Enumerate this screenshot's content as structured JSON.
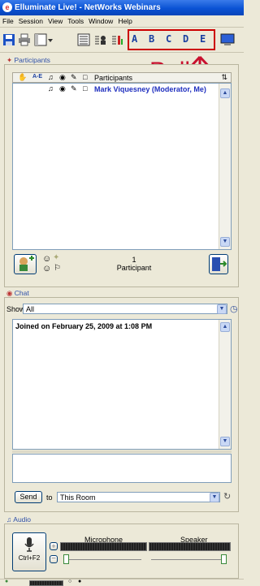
{
  "window": {
    "title": "Elluminate Live! - NetWorks Webinars"
  },
  "menu": [
    "File",
    "Session",
    "View",
    "Tools",
    "Window",
    "Help"
  ],
  "toolbar": {
    "poll_buttons": [
      "A",
      "B",
      "C",
      "D",
      "E"
    ]
  },
  "annotation": {
    "label": "Poll"
  },
  "participants": {
    "panel_title": "Participants",
    "column_header": "Participants",
    "list": [
      {
        "name": "Mark Viquesney (Moderator, Me)"
      }
    ],
    "count": "1",
    "count_label": "Participant"
  },
  "chat": {
    "panel_title": "Chat",
    "show_label": "Show",
    "show_value": "All",
    "messages": [
      "Joined on February 25, 2009 at 1:08 PM"
    ],
    "send_label": "Send",
    "to_label": "to",
    "recipient": "This Room"
  },
  "audio": {
    "panel_title": "Audio",
    "microphone_label": "Microphone",
    "speaker_label": "Speaker",
    "hotkey": "Ctrl+F2"
  }
}
